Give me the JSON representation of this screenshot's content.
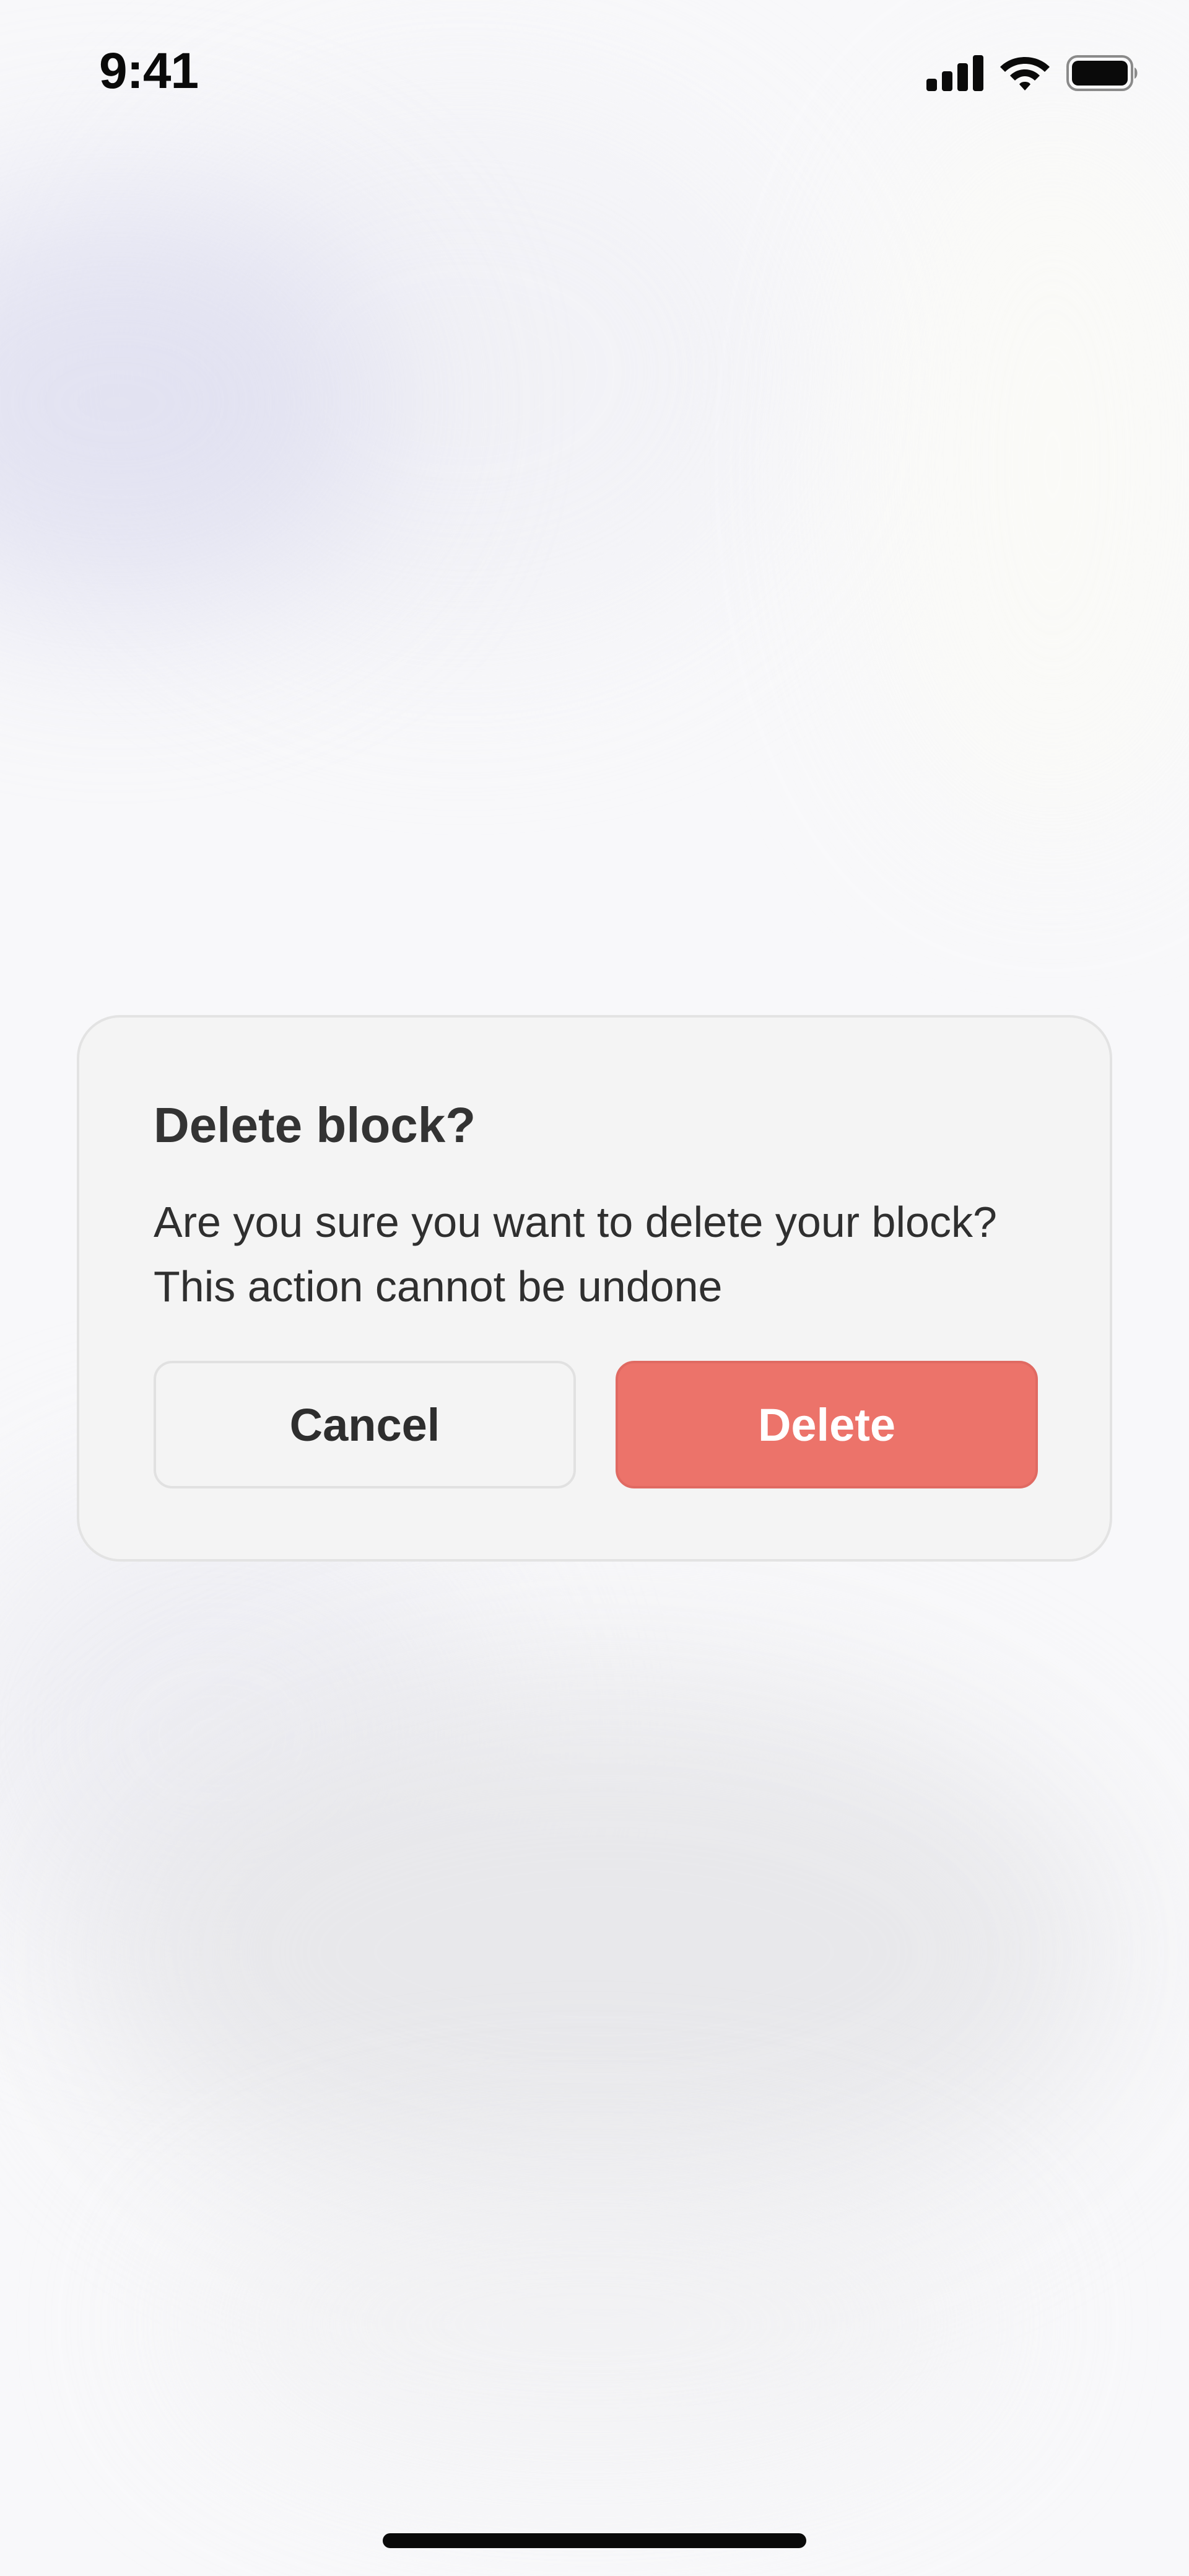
{
  "status_bar": {
    "time": "9:41",
    "icons": [
      "cellular-signal-icon",
      "wifi-icon",
      "battery-icon"
    ]
  },
  "dialog": {
    "title": "Delete block?",
    "message": "Are you sure you want to delete your block? This action cannot be undone",
    "cancel_label": "Cancel",
    "delete_label": "Delete"
  },
  "colors": {
    "delete_button": "#ec736a",
    "dialog_background": "#f4f4f4",
    "text_primary": "#333333"
  }
}
